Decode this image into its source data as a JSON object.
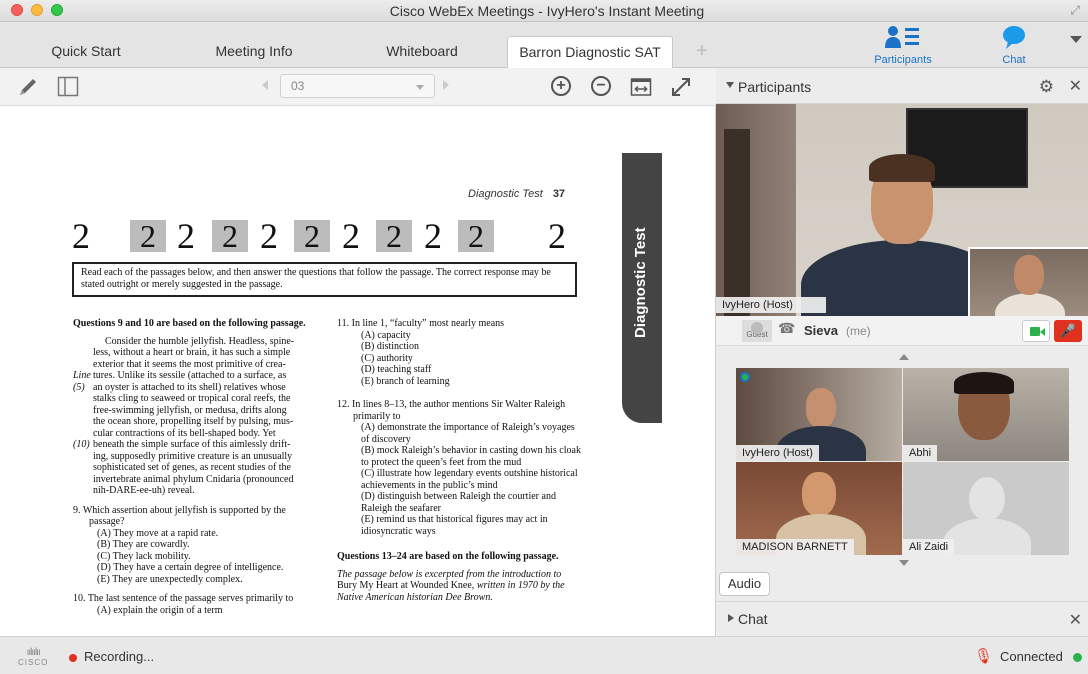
{
  "window": {
    "title": "Cisco WebEx Meetings - IvyHero's Instant Meeting"
  },
  "tabs": [
    {
      "label": "Quick Start"
    },
    {
      "label": "Meeting Info"
    },
    {
      "label": "Whiteboard"
    },
    {
      "label": "Barron Diagnostic SAT",
      "active": true
    }
  ],
  "header_buttons": {
    "participants": "Participants",
    "chat": "Chat"
  },
  "toolbar": {
    "page_value": "03"
  },
  "document": {
    "running_head": "Diagnostic Test",
    "page_number": "37",
    "side_tab": "Diagnostic Test",
    "section_number": "2",
    "instructions": "Read each of the passages below, and then answer the questions that follow the passage. The correct response may be stated outright or merely suggested in the passage.",
    "col1": {
      "heading": "Questions 9 and 10 are based on the following passage.",
      "passage": [
        {
          "label": "",
          "text": "Consider the humble jellyfish. Headless, spine-"
        },
        {
          "label": "",
          "text": "less, without a heart or brain, it has such a simple"
        },
        {
          "label": "",
          "text": "exterior that it seems the most primitive of crea-"
        },
        {
          "label": "Line",
          "text": "tures. Unlike its sessile (attached to a surface, as"
        },
        {
          "label": "(5)",
          "text": "an oyster is attached to its shell) relatives whose"
        },
        {
          "label": "",
          "text": "stalks cling to seaweed or tropical coral reefs, the"
        },
        {
          "label": "",
          "text": "free-swimming jellyfish, or medusa, drifts along"
        },
        {
          "label": "",
          "text": "the ocean shore, propelling itself by pulsing, mus-"
        },
        {
          "label": "",
          "text": "cular contractions of its bell-shaped body. Yet"
        },
        {
          "label": "(10)",
          "text": "beneath the simple surface of this aimlessly drift-"
        },
        {
          "label": "",
          "text": "ing, supposedly primitive creature is an unusually"
        },
        {
          "label": "",
          "text": "sophisticated set of genes, as recent studies of the"
        },
        {
          "label": "",
          "text": "invertebrate animal phylum Cnidaria (pronounced"
        },
        {
          "label": "",
          "text": "nih-DARE-ee-uh) reveal."
        }
      ],
      "q9": {
        "stem": "9. Which assertion about jellyfish is supported by the passage?",
        "options": [
          "(A) They move at a rapid rate.",
          "(B) They are cowardly.",
          "(C) They lack mobility.",
          "(D) They have a certain degree of intelligence.",
          "(E) They are unexpectedly complex."
        ]
      },
      "q10": {
        "stem": "10. The last sentence of the passage serves primarily to",
        "options": [
          "(A) explain the origin of a term"
        ]
      }
    },
    "col2": {
      "q11": {
        "stem": "11. In line 1, “faculty” most nearly means",
        "options": [
          "(A) capacity",
          "(B) distinction",
          "(C) authority",
          "(D) teaching staff",
          "(E) branch of learning"
        ]
      },
      "q12": {
        "stem": "12. In lines 8–13, the author mentions Sir Walter Raleigh primarily to",
        "options": [
          "(A) demonstrate the importance of Raleigh’s voyages of discovery",
          "(B) mock Raleigh’s behavior in casting down his cloak to protect the queen’s feet from the mud",
          "(C) illustrate how legendary events outshine historical achievements in the public’s mind",
          "(D) distinguish between Raleigh the courtier and Raleigh the seafarer",
          "(E) remind us that historical figures may act in idiosyncratic ways"
        ]
      },
      "heading2": "Questions 13–24 are based on the following passage.",
      "intro_a": "The passage below is excerpted from the introduction to",
      "intro_b": "Bury My Heart at Wounded Knee,",
      "intro_c": " written in 1970 by the Native American historian Dee Brown."
    }
  },
  "participants_panel": {
    "title": "Participants",
    "main_video_name": "IvyHero (Host)",
    "me": {
      "guest_label": "Guest",
      "name": "Sieva",
      "suffix": "(me)"
    },
    "tiles": [
      {
        "name": "IvyHero (Host)"
      },
      {
        "name": "Abhi"
      },
      {
        "name": "MADISON BARNETT"
      },
      {
        "name": "Ali Zaidi"
      }
    ],
    "audio_button": "Audio"
  },
  "chat_panel": {
    "title": "Chat"
  },
  "status": {
    "brand": "CISCO",
    "recording": "Recording...",
    "connection": "Connected"
  },
  "colors": {
    "accent": "#1a73c9",
    "record": "#e0301e",
    "connected": "#2bb24c"
  }
}
